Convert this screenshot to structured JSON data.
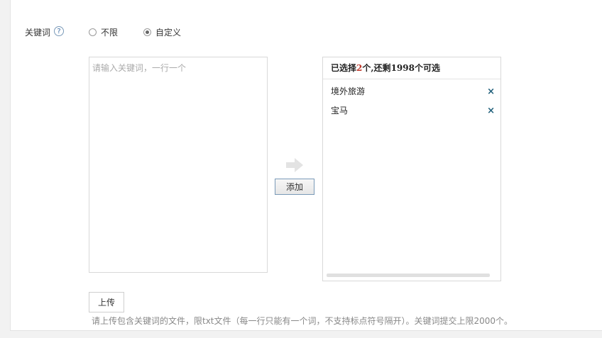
{
  "form": {
    "keyword_label": "关键词",
    "help_symbol": "?",
    "radio_unlimited": "不限",
    "radio_custom": "自定义",
    "textarea_placeholder": "请输入关键词，一行一个",
    "add_button": "添加",
    "upload_button": "上传",
    "hint": "请上传包含关键词的文件，限txt文件（每一行只能有一个词，不支持标点符号隔开）。关键词提交上限2000个。"
  },
  "selected": {
    "prefix": "已选择",
    "count": "2",
    "middle": "个,还剩",
    "remaining": "1998",
    "suffix": "个可选",
    "items": [
      {
        "label": "境外旅游"
      },
      {
        "label": "宝马"
      }
    ],
    "remove_symbol": "×"
  },
  "colors": {
    "accent_count": "#c0392b",
    "remove_icon": "#1f5f7a"
  }
}
